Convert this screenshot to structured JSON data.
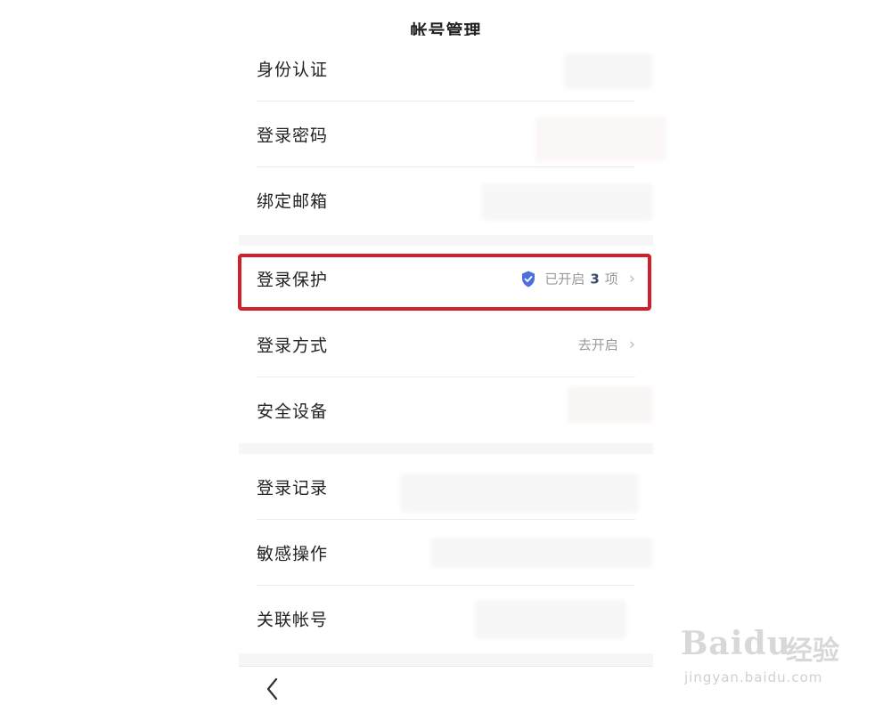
{
  "header": {
    "title": "帐号管理"
  },
  "group1": [
    {
      "label": "身份认证"
    },
    {
      "label": "登录密码"
    },
    {
      "label": "绑定邮箱"
    }
  ],
  "group2": [
    {
      "label": "登录保护",
      "status_prefix": "已开启",
      "status_count": "3",
      "status_suffix": "项",
      "icon": "shield-check-icon",
      "highlighted": true
    },
    {
      "label": "登录方式",
      "status": "去开启"
    },
    {
      "label": "安全设备"
    }
  ],
  "group3": [
    {
      "label": "登录记录"
    },
    {
      "label": "敏感操作"
    },
    {
      "label": "关联帐号"
    }
  ],
  "watermark": {
    "brand": "Bai",
    "brand_du": "du",
    "cn": "经验",
    "url": "jingyan.baidu.com"
  },
  "colors": {
    "highlight": "#d1202a",
    "shield": "#4b6ee0",
    "gap": "#f6f6f7"
  }
}
